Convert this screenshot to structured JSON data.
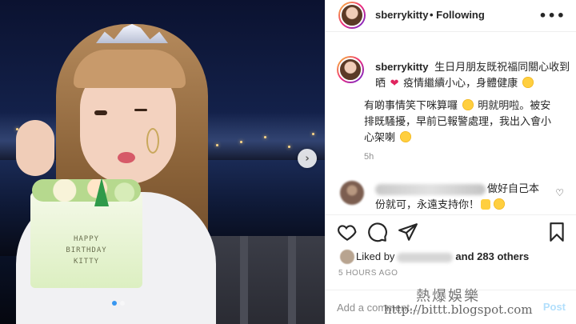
{
  "post": {
    "username": "sberrykitty",
    "follow_status": "• Following",
    "more_label": "•••",
    "photo_text": "HAPPY BIRTHDAY KITTY",
    "carousel": {
      "slides": 2,
      "current": 1
    }
  },
  "caption": {
    "username": "sberrykitty",
    "line1": "生日月朋友既祝福同關心收到晒",
    "line1b": "疫情繼續小心，身體健康",
    "line2": "有啲事情笑下咪算囉",
    "line2b": "明就明啦。被安排既騷擾，早前已報警處理，我出入會小心架喇",
    "time": "5h"
  },
  "comment": {
    "text_a": "做好自己本份就",
    "text_b": "可，永遠支持你！"
  },
  "likes": {
    "prefix": "Liked by",
    "suffix": "and 283 others"
  },
  "posted": "5 HOURS AGO",
  "add_comment": {
    "placeholder": "Add a comment...",
    "post_label": "Post"
  },
  "watermark": {
    "title": "熱爆娛樂",
    "url": "http://bittt.blogspot.com"
  },
  "icons": [
    "next-arrow-icon",
    "heart-icon",
    "comment-icon",
    "share-icon",
    "bookmark-icon",
    "more-icon"
  ],
  "colors": {
    "accent": "#3897f0",
    "muted": "#8e8e8e",
    "text": "#262626",
    "heart": "#e0245e"
  }
}
